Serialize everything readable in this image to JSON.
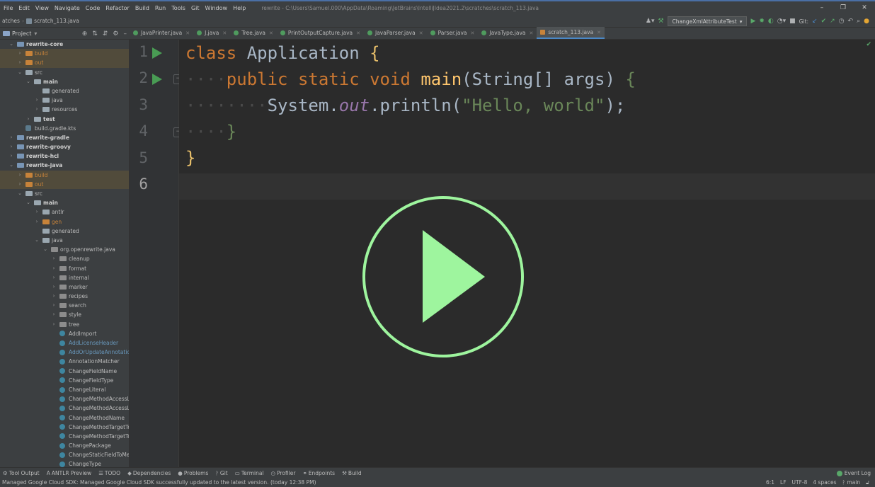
{
  "menu": [
    "File",
    "Edit",
    "View",
    "Navigate",
    "Code",
    "Refactor",
    "Build",
    "Run",
    "Tools",
    "Git",
    "Window",
    "Help"
  ],
  "window_title": "rewrite - C:\\Users\\Samuel.000\\AppData\\Roaming\\JetBrains\\IntelliJIdea2021.2\\scratches\\scratch_113.java",
  "window_controls": {
    "minimize": "–",
    "restore": "❐",
    "close": "✕"
  },
  "breadcrumb": {
    "root": "atches",
    "file": "scratch_113.java"
  },
  "toolbar": {
    "run_config": "ChangeXmlAttributeTest",
    "git_label": "Git:"
  },
  "sidebar": {
    "title": "Project"
  },
  "tabs": [
    {
      "label": "JavaPrinter.java",
      "active": false
    },
    {
      "label": "J.java",
      "active": false
    },
    {
      "label": "Tree.java",
      "active": false
    },
    {
      "label": "PrintOutputCapture.java",
      "active": false
    },
    {
      "label": "JavaParser.java",
      "active": false
    },
    {
      "label": "Parser.java",
      "active": false
    },
    {
      "label": "JavaType.java",
      "active": false
    },
    {
      "label": "scratch_113.java",
      "active": true
    }
  ],
  "tree": [
    {
      "label": "rewrite-core",
      "depth": 1,
      "arrow": "open",
      "icon": "mod",
      "style": "bold"
    },
    {
      "label": "build",
      "depth": 2,
      "arrow": "closed",
      "icon": "orange",
      "style": "orange",
      "hl": true
    },
    {
      "label": "out",
      "depth": 2,
      "arrow": "closed",
      "icon": "orange",
      "style": "orange",
      "hl": true
    },
    {
      "label": "src",
      "depth": 2,
      "arrow": "open",
      "icon": "grey",
      "style": ""
    },
    {
      "label": "main",
      "depth": 3,
      "arrow": "open",
      "icon": "grey",
      "style": "bold"
    },
    {
      "label": "generated",
      "depth": 4,
      "arrow": "none",
      "icon": "grey",
      "style": ""
    },
    {
      "label": "java",
      "depth": 4,
      "arrow": "closed",
      "icon": "grey",
      "style": ""
    },
    {
      "label": "resources",
      "depth": 4,
      "arrow": "closed",
      "icon": "grey",
      "style": ""
    },
    {
      "label": "test",
      "depth": 3,
      "arrow": "closed",
      "icon": "grey",
      "style": "bold"
    },
    {
      "label": "build.gradle.kts",
      "depth": 2,
      "arrow": "none",
      "icon": "gradle",
      "style": ""
    },
    {
      "label": "rewrite-gradle",
      "depth": 1,
      "arrow": "closed",
      "icon": "mod",
      "style": "bold"
    },
    {
      "label": "rewrite-groovy",
      "depth": 1,
      "arrow": "closed",
      "icon": "mod",
      "style": "bold"
    },
    {
      "label": "rewrite-hcl",
      "depth": 1,
      "arrow": "closed",
      "icon": "mod",
      "style": "bold"
    },
    {
      "label": "rewrite-java",
      "depth": 1,
      "arrow": "open",
      "icon": "mod",
      "style": "bold"
    },
    {
      "label": "build",
      "depth": 2,
      "arrow": "closed",
      "icon": "orange",
      "style": "orange",
      "hl": true
    },
    {
      "label": "out",
      "depth": 2,
      "arrow": "closed",
      "icon": "orange",
      "style": "orange",
      "hl": true
    },
    {
      "label": "src",
      "depth": 2,
      "arrow": "open",
      "icon": "grey",
      "style": ""
    },
    {
      "label": "main",
      "depth": 3,
      "arrow": "open",
      "icon": "grey",
      "style": "bold"
    },
    {
      "label": "antlr",
      "depth": 4,
      "arrow": "closed",
      "icon": "grey",
      "style": ""
    },
    {
      "label": "gen",
      "depth": 4,
      "arrow": "closed",
      "icon": "orange",
      "style": "orange"
    },
    {
      "label": "generated",
      "depth": 4,
      "arrow": "none",
      "icon": "grey",
      "style": ""
    },
    {
      "label": "java",
      "depth": 4,
      "arrow": "open",
      "icon": "grey",
      "style": ""
    },
    {
      "label": "org.openrewrite.java",
      "depth": 5,
      "arrow": "open",
      "icon": "pkg",
      "style": ""
    },
    {
      "label": "cleanup",
      "depth": 6,
      "arrow": "closed",
      "icon": "pkg",
      "style": ""
    },
    {
      "label": "format",
      "depth": 6,
      "arrow": "closed",
      "icon": "pkg",
      "style": ""
    },
    {
      "label": "internal",
      "depth": 6,
      "arrow": "closed",
      "icon": "pkg",
      "style": ""
    },
    {
      "label": "marker",
      "depth": 6,
      "arrow": "closed",
      "icon": "pkg",
      "style": ""
    },
    {
      "label": "recipes",
      "depth": 6,
      "arrow": "closed",
      "icon": "pkg",
      "style": ""
    },
    {
      "label": "search",
      "depth": 6,
      "arrow": "closed",
      "icon": "pkg",
      "style": ""
    },
    {
      "label": "style",
      "depth": 6,
      "arrow": "closed",
      "icon": "pkg",
      "style": ""
    },
    {
      "label": "tree",
      "depth": 6,
      "arrow": "closed",
      "icon": "pkg",
      "style": ""
    },
    {
      "label": "AddImport",
      "depth": 6,
      "arrow": "none",
      "icon": "class",
      "style": ""
    },
    {
      "label": "AddLicenseHeader",
      "depth": 6,
      "arrow": "none",
      "icon": "class",
      "style": "blue"
    },
    {
      "label": "AddOrUpdateAnnotationAttribute",
      "depth": 6,
      "arrow": "none",
      "icon": "class",
      "style": "blue"
    },
    {
      "label": "AnnotationMatcher",
      "depth": 6,
      "arrow": "none",
      "icon": "class",
      "style": ""
    },
    {
      "label": "ChangeFieldName",
      "depth": 6,
      "arrow": "none",
      "icon": "class",
      "style": ""
    },
    {
      "label": "ChangeFieldType",
      "depth": 6,
      "arrow": "none",
      "icon": "class",
      "style": ""
    },
    {
      "label": "ChangeLiteral",
      "depth": 6,
      "arrow": "none",
      "icon": "class",
      "style": ""
    },
    {
      "label": "ChangeMethodAccessLevel",
      "depth": 6,
      "arrow": "none",
      "icon": "class",
      "style": ""
    },
    {
      "label": "ChangeMethodAccessLevelVisitor",
      "depth": 6,
      "arrow": "none",
      "icon": "class",
      "style": ""
    },
    {
      "label": "ChangeMethodName",
      "depth": 6,
      "arrow": "none",
      "icon": "class",
      "style": ""
    },
    {
      "label": "ChangeMethodTargetToStatic",
      "depth": 6,
      "arrow": "none",
      "icon": "class",
      "style": ""
    },
    {
      "label": "ChangeMethodTargetToVariable",
      "depth": 6,
      "arrow": "none",
      "icon": "class",
      "style": ""
    },
    {
      "label": "ChangePackage",
      "depth": 6,
      "arrow": "none",
      "icon": "class",
      "style": ""
    },
    {
      "label": "ChangeStaticFieldToMethod",
      "depth": 6,
      "arrow": "none",
      "icon": "class",
      "style": ""
    },
    {
      "label": "ChangeType",
      "depth": 6,
      "arrow": "none",
      "icon": "class",
      "style": ""
    }
  ],
  "line_numbers": [
    "1",
    "2",
    "3",
    "4",
    "5",
    "6"
  ],
  "code": {
    "l1_kw": "class",
    "l1_name": "Application",
    "l1_brace": "{",
    "l2_ws": "····",
    "l2_kw": "public static void",
    "l2_fn": "main",
    "l2_open": "(",
    "l2_type": "String[] args",
    "l2_close": ")",
    "l2_brace": "{",
    "l3_ws": "········",
    "l3_obj": "System.",
    "l3_field": "out",
    "l3_call": ".println(",
    "l3_str": "\"Hello, world\"",
    "l3_end": ");",
    "l4_ws": "····",
    "l4_brace": "}",
    "l5_brace": "}"
  },
  "tool_windows": [
    {
      "icon": "⚙",
      "label": "Tool Output"
    },
    {
      "icon": "A",
      "label": "ANTLR Preview"
    },
    {
      "icon": "☰",
      "label": "TODO"
    },
    {
      "icon": "◆",
      "label": "Dependencies"
    },
    {
      "icon": "●",
      "label": "Problems"
    },
    {
      "icon": "ᚹ",
      "label": "Git"
    },
    {
      "icon": "▭",
      "label": "Terminal"
    },
    {
      "icon": "◷",
      "label": "Profiler"
    },
    {
      "icon": "⚭",
      "label": "Endpoints"
    },
    {
      "icon": "⚒",
      "label": "Build"
    }
  ],
  "event_log": "Event Log",
  "status": {
    "message": "Managed Google Cloud SDK: Managed Google Cloud SDK successfully updated to the latest version. (today 12:38 PM)",
    "position": "6:1",
    "line_sep": "LF",
    "encoding": "UTF-8",
    "indent": "4 spaces",
    "branch": "main"
  },
  "colors": {
    "accent": "#4a88c7",
    "play_overlay": "#9ef59e",
    "keyword": "#cc7832",
    "string": "#6a8759"
  }
}
